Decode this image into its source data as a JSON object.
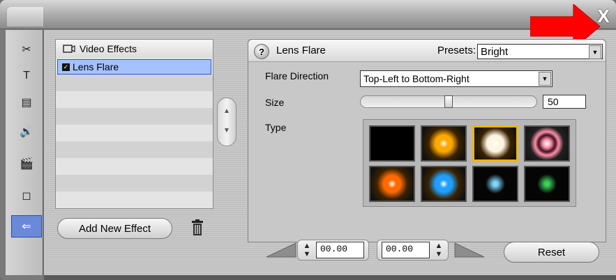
{
  "window": {
    "close_label": "X"
  },
  "toolbar": {
    "items": [
      {
        "icon": "tools-icon",
        "glyph": "✂"
      },
      {
        "icon": "text-icon",
        "glyph": "T"
      },
      {
        "icon": "menu-icon",
        "glyph": "▤"
      },
      {
        "icon": "audio-icon",
        "glyph": "🔊"
      },
      {
        "icon": "clapper-icon",
        "glyph": "🎬"
      },
      {
        "icon": "frame-icon",
        "glyph": "◻"
      },
      {
        "icon": "plugin-icon",
        "glyph": "⇐"
      }
    ],
    "active_index": 6
  },
  "effects_list": {
    "header": "Video Effects",
    "items": [
      "Lens Flare"
    ],
    "selected": "Lens Flare"
  },
  "buttons": {
    "add_new_effect": "Add New Effect",
    "reset": "Reset"
  },
  "effect": {
    "title": "Lens Flare",
    "help_label": "?",
    "presets_label": "Presets:",
    "preset_value": "Bright",
    "flare_direction_label": "Flare Direction",
    "flare_direction_value": "Top-Left to Bottom-Right",
    "size_label": "Size",
    "size_value": "50",
    "size_fraction": 0.5,
    "type_label": "Type",
    "type_selected_index": 2,
    "types": [
      {
        "name": "none",
        "color": "#000000"
      },
      {
        "name": "orange",
        "color": "#ffa800"
      },
      {
        "name": "white",
        "color": "#fff4e0"
      },
      {
        "name": "pink-ring",
        "color": "#ff8fa8"
      },
      {
        "name": "red-orange",
        "color": "#ff6a00"
      },
      {
        "name": "blue",
        "color": "#1fa0ff"
      },
      {
        "name": "cyan-star",
        "color": "#7fd7ff"
      },
      {
        "name": "green-star",
        "color": "#3ccf5a"
      }
    ]
  },
  "timecode": {
    "start": "00.00",
    "end": "00.00"
  },
  "colors": {
    "selection": "#a4c2ff",
    "selected_swatch": "#f2b600",
    "annotation_arrow": "#ff0000"
  }
}
